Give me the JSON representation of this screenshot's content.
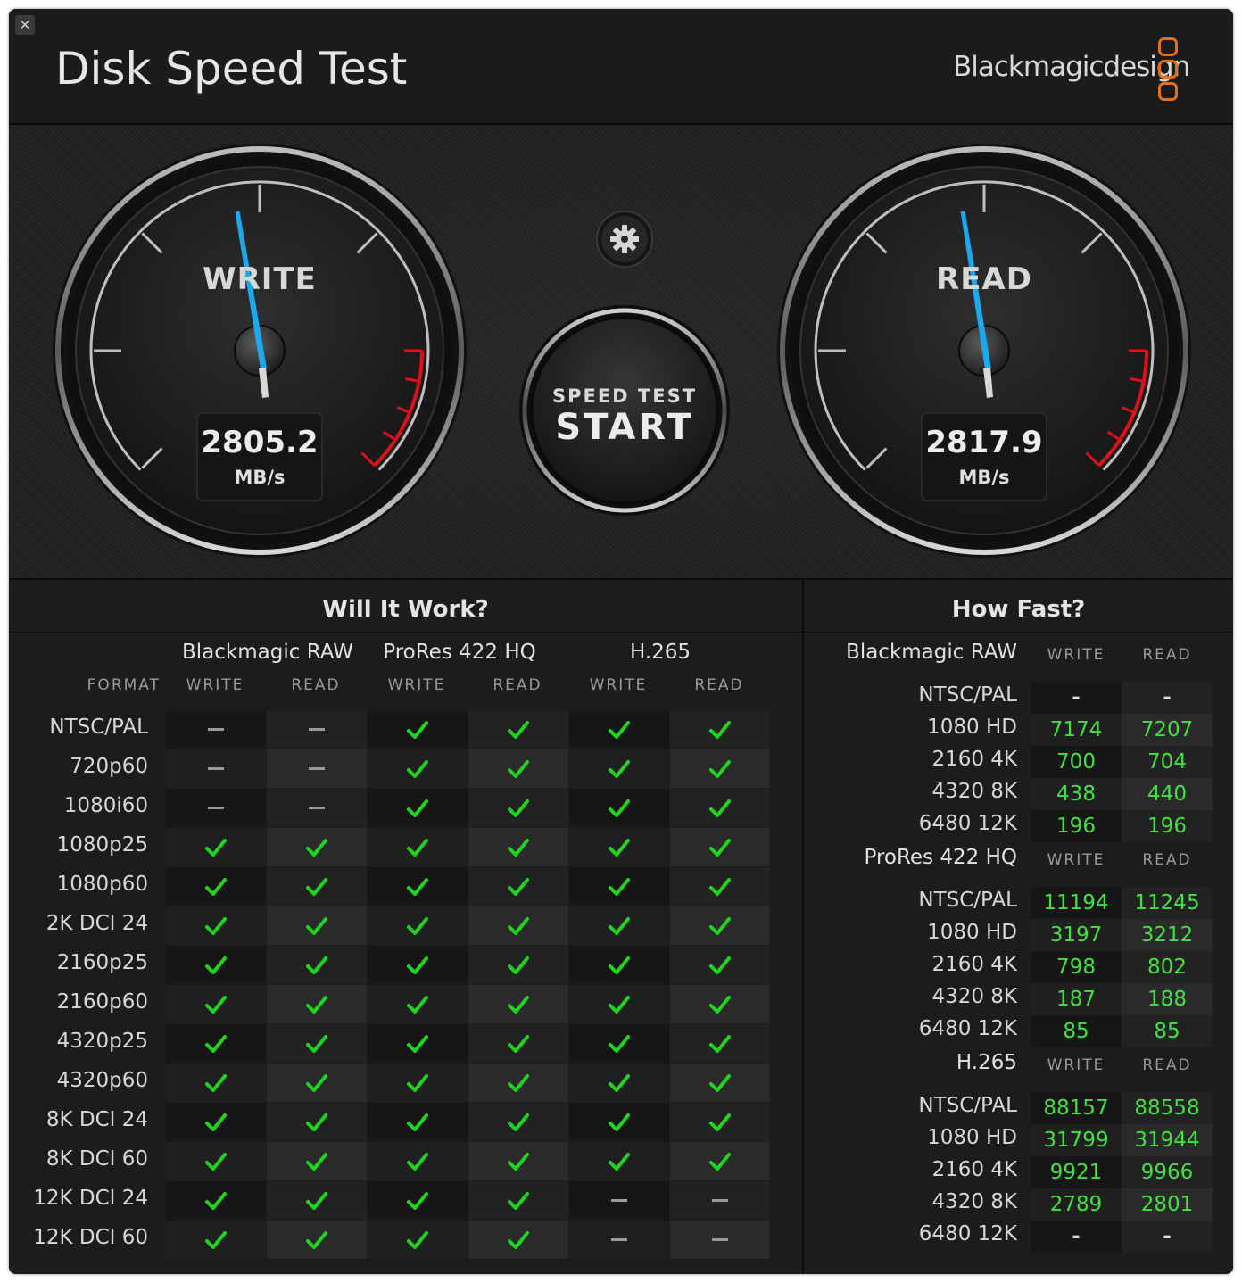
{
  "window": {
    "close_label": "✕"
  },
  "header": {
    "title": "Disk Speed Test",
    "brand": "Blackmagicdesign",
    "brand_accent": "#e0701c"
  },
  "write_gauge": {
    "label": "WRITE",
    "value": "2805.2",
    "unit": "MB/s",
    "needle_color": "#1aa9ef"
  },
  "read_gauge": {
    "label": "READ",
    "value": "2817.9",
    "unit": "MB/s",
    "needle_color": "#1aa9ef"
  },
  "settings": {
    "icon": "gear-icon"
  },
  "start_button": {
    "top": "SPEED TEST",
    "main": "START"
  },
  "will_it_work": {
    "title": "Will It Work?",
    "format_header": "FORMAT",
    "codecs": [
      "Blackmagic RAW",
      "ProRes 422 HQ",
      "H.265"
    ],
    "subheaders": [
      "WRITE",
      "READ",
      "WRITE",
      "READ",
      "WRITE",
      "READ"
    ],
    "rows": [
      {
        "label": "NTSC/PAL",
        "cells": [
          "dash",
          "dash",
          "check",
          "check",
          "check",
          "check"
        ]
      },
      {
        "label": "720p60",
        "cells": [
          "dash",
          "dash",
          "check",
          "check",
          "check",
          "check"
        ]
      },
      {
        "label": "1080i60",
        "cells": [
          "dash",
          "dash",
          "check",
          "check",
          "check",
          "check"
        ]
      },
      {
        "label": "1080p25",
        "cells": [
          "check",
          "check",
          "check",
          "check",
          "check",
          "check"
        ]
      },
      {
        "label": "1080p60",
        "cells": [
          "check",
          "check",
          "check",
          "check",
          "check",
          "check"
        ]
      },
      {
        "label": "2K DCI 24",
        "cells": [
          "check",
          "check",
          "check",
          "check",
          "check",
          "check"
        ]
      },
      {
        "label": "2160p25",
        "cells": [
          "check",
          "check",
          "check",
          "check",
          "check",
          "check"
        ]
      },
      {
        "label": "2160p60",
        "cells": [
          "check",
          "check",
          "check",
          "check",
          "check",
          "check"
        ]
      },
      {
        "label": "4320p25",
        "cells": [
          "check",
          "check",
          "check",
          "check",
          "check",
          "check"
        ]
      },
      {
        "label": "4320p60",
        "cells": [
          "check",
          "check",
          "check",
          "check",
          "check",
          "check"
        ]
      },
      {
        "label": "8K DCI 24",
        "cells": [
          "check",
          "check",
          "check",
          "check",
          "check",
          "check"
        ]
      },
      {
        "label": "8K DCI 60",
        "cells": [
          "check",
          "check",
          "check",
          "check",
          "check",
          "check"
        ]
      },
      {
        "label": "12K DCI 24",
        "cells": [
          "check",
          "check",
          "check",
          "check",
          "dash",
          "dash"
        ]
      },
      {
        "label": "12K DCI 60",
        "cells": [
          "check",
          "check",
          "check",
          "check",
          "dash",
          "dash"
        ]
      }
    ]
  },
  "how_fast": {
    "title": "How Fast?",
    "groups": [
      {
        "name": "Blackmagic RAW",
        "write_header": "WRITE",
        "read_header": "READ",
        "rows": [
          {
            "label": "NTSC/PAL",
            "write": "-",
            "read": "-"
          },
          {
            "label": "1080 HD",
            "write": "7174",
            "read": "7207"
          },
          {
            "label": "2160 4K",
            "write": "700",
            "read": "704"
          },
          {
            "label": "4320 8K",
            "write": "438",
            "read": "440"
          },
          {
            "label": "6480 12K",
            "write": "196",
            "read": "196"
          }
        ]
      },
      {
        "name": "ProRes 422 HQ",
        "write_header": "WRITE",
        "read_header": "READ",
        "rows": [
          {
            "label": "NTSC/PAL",
            "write": "11194",
            "read": "11245"
          },
          {
            "label": "1080 HD",
            "write": "3197",
            "read": "3212"
          },
          {
            "label": "2160 4K",
            "write": "798",
            "read": "802"
          },
          {
            "label": "4320 8K",
            "write": "187",
            "read": "188"
          },
          {
            "label": "6480 12K",
            "write": "85",
            "read": "85"
          }
        ]
      },
      {
        "name": "H.265",
        "write_header": "WRITE",
        "read_header": "READ",
        "rows": [
          {
            "label": "NTSC/PAL",
            "write": "88157",
            "read": "88558"
          },
          {
            "label": "1080 HD",
            "write": "31799",
            "read": "31944"
          },
          {
            "label": "2160 4K",
            "write": "9921",
            "read": "9966"
          },
          {
            "label": "4320 8K",
            "write": "2789",
            "read": "2801"
          },
          {
            "label": "6480 12K",
            "write": "-",
            "read": "-"
          }
        ]
      }
    ]
  },
  "colors": {
    "check": "#1fd61f",
    "value": "#3fe23f",
    "redzone": "#e0101a"
  }
}
